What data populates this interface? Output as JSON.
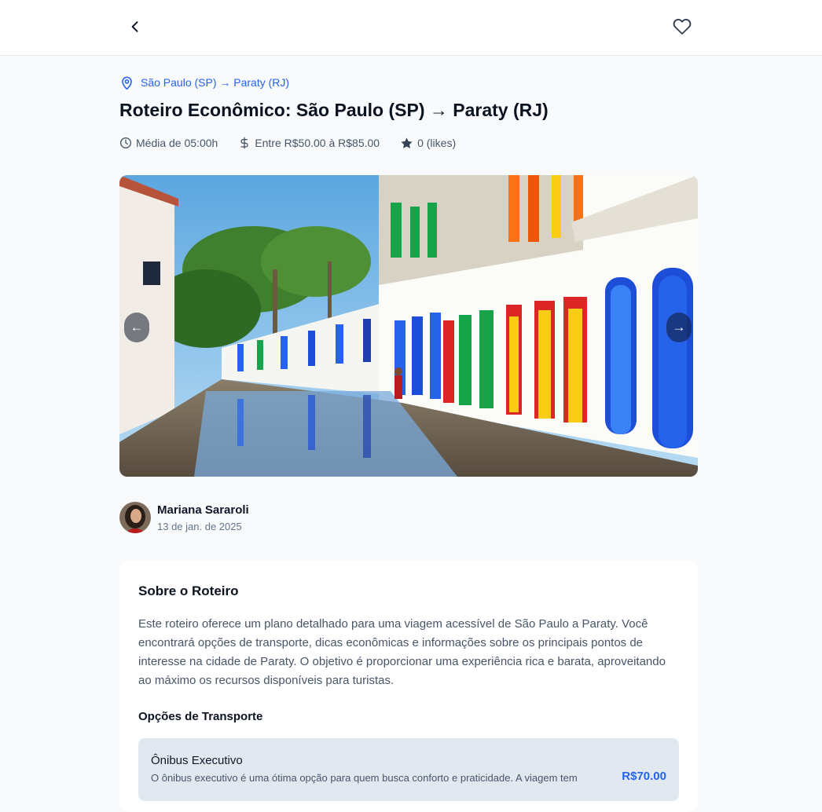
{
  "header": {
    "back_icon": "chevron-left-icon",
    "favorite_icon": "heart-icon"
  },
  "route": {
    "icon": "map-pin-icon",
    "label": "São Paulo (SP) → Paraty (RJ)",
    "color": "#2563eb"
  },
  "title": "Roteiro Econômico: São Paulo (SP) → Paraty (RJ)",
  "meta": {
    "duration": "Média de 05:00h",
    "price_range": "Entre R$50.00 à R$85.00",
    "likes": "0 (likes)"
  },
  "gallery": {
    "prev_label": "←",
    "next_label": "→"
  },
  "author": {
    "name": "Mariana Sararoli",
    "date": "13 de jan. de 2025"
  },
  "about": {
    "title": "Sobre o Roteiro",
    "description": "Este roteiro oferece um plano detalhado para uma viagem acessível de São Paulo a Paraty. Você encontrará opções de transporte, dicas econômicas e informações sobre os principais pontos de interesse na cidade de Paraty. O objetivo é proporcionar uma experiência rica e barata, aproveitando ao máximo os recursos disponíveis para turistas."
  },
  "transport": {
    "section_title": "Opções de Transporte",
    "options": [
      {
        "name": "Ônibus Executivo",
        "description": "O ônibus executivo é uma ótima opção para quem busca conforto e praticidade. A viagem tem",
        "price": "R$70.00"
      }
    ]
  }
}
